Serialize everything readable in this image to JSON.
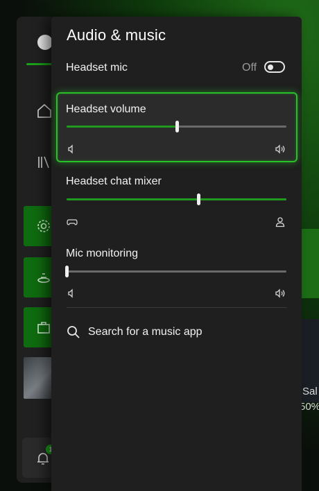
{
  "panel": {
    "title": "Audio & music",
    "headset_mic": {
      "label": "Headset mic",
      "state_text": "Off",
      "on": false
    },
    "headset_volume": {
      "label": "Headset volume",
      "value": 0.5
    },
    "headset_chat_mixer": {
      "label": "Headset chat mixer",
      "value": 0.6
    },
    "mic_monitoring": {
      "label": "Mic monitoring",
      "value": 0.0
    },
    "search_music": {
      "label": "Search for a music app",
      "icon": "search-icon"
    }
  },
  "background": {
    "sale_text": "Sal",
    "percent_text": "50%",
    "notification_count": "1"
  },
  "colors": {
    "accent": "#1f9a1f",
    "focus": "#28c128",
    "panel_bg": "#1f1f1f"
  }
}
